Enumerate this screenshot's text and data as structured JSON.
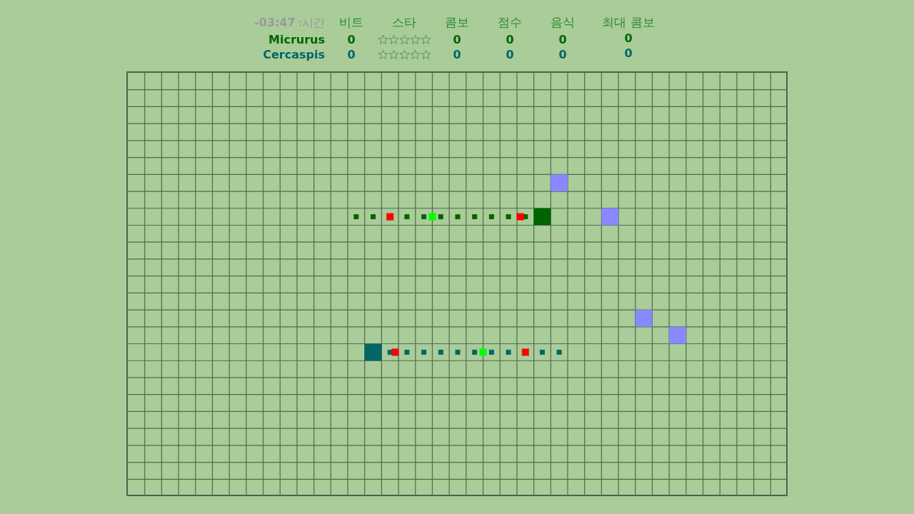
{
  "header": {
    "time": "-03:47",
    "time_label": ":시간",
    "columns": [
      "비트",
      "스타",
      "콤보",
      "점수",
      "음식",
      "최대 콤보"
    ]
  },
  "players": [
    {
      "name": "Micrurus",
      "color": "#006400",
      "beat": "0",
      "stars": 0,
      "combo": "0",
      "score": "0",
      "food": "0",
      "max_combo": "0"
    },
    {
      "name": "Cercaspis",
      "color": "#006666",
      "beat": "0",
      "stars": 0,
      "combo": "0",
      "score": "0",
      "food": "0",
      "max_combo": "0"
    }
  ]
}
